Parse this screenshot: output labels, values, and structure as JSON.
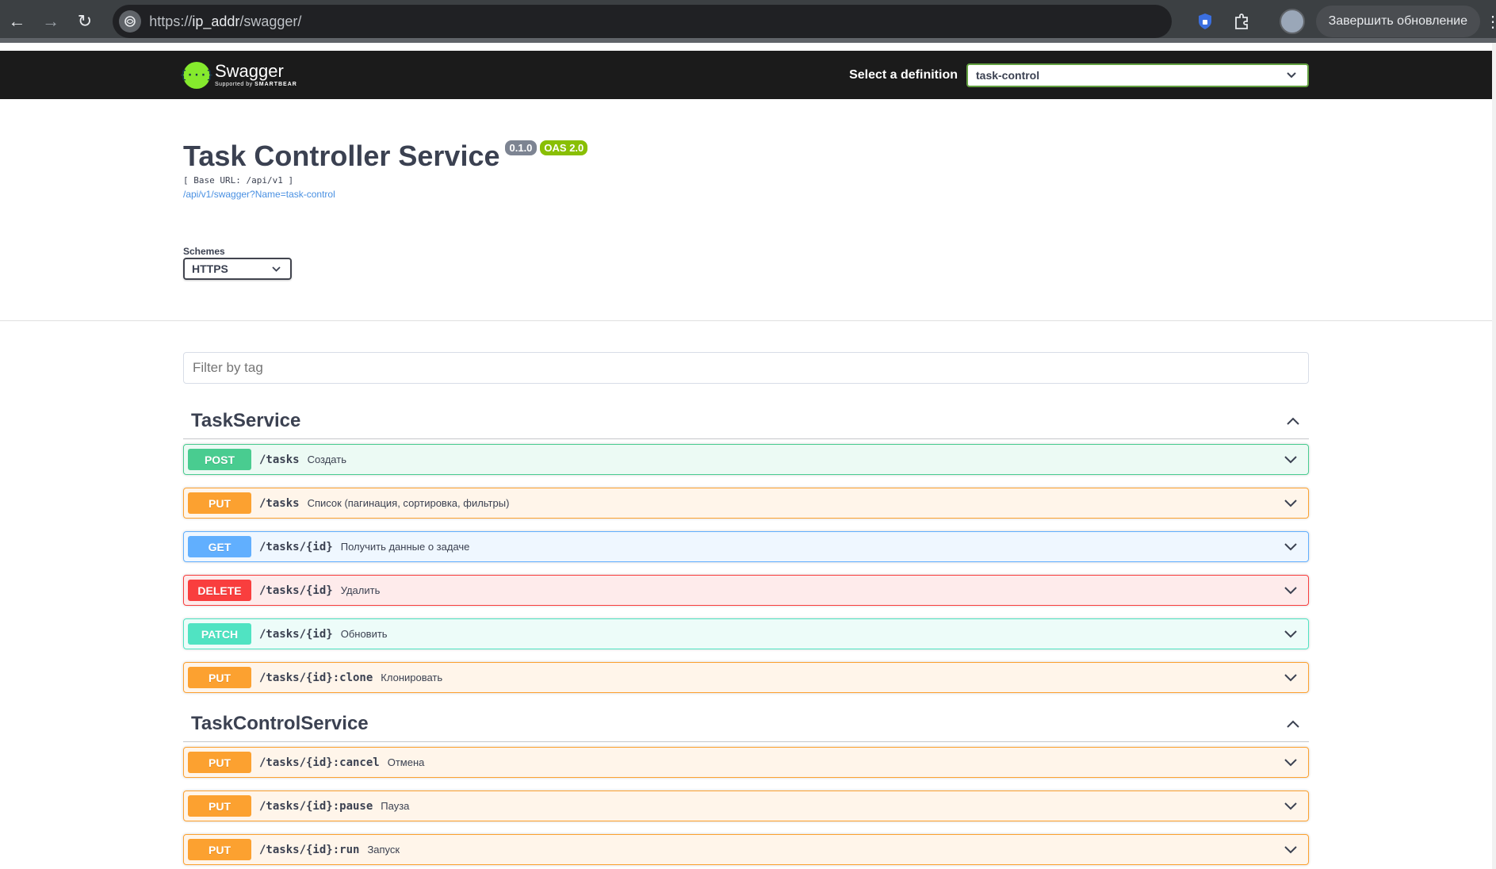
{
  "browser": {
    "url_prefix": "https://",
    "url_host": "ip_addr",
    "url_path": "/swagger/",
    "update_label": "Завершить обновление"
  },
  "topbar": {
    "brand_name": "Swagger",
    "brand_sub": "Supported by",
    "brand_sub_strong": "SMARTBEAR",
    "definition_label": "Select a definition",
    "definition_value": "task-control"
  },
  "info": {
    "title": "Task Controller Service",
    "version": "0.1.0",
    "oas": "OAS 2.0",
    "base_url": "[ Base URL: /api/v1 ]",
    "spec_link": "/api/v1/swagger?Name=task-control",
    "schemes_label": "Schemes",
    "schemes_value": "HTTPS"
  },
  "filter": {
    "placeholder": "Filter by tag"
  },
  "sections": [
    {
      "name": "TaskService",
      "ops": [
        {
          "method": "POST",
          "path": "/tasks",
          "summary": "Создать"
        },
        {
          "method": "PUT",
          "path": "/tasks",
          "summary": "Список (пагинация, сортировка, фильтры)"
        },
        {
          "method": "GET",
          "path": "/tasks/{id}",
          "summary": "Получить данные о задаче"
        },
        {
          "method": "DELETE",
          "path": "/tasks/{id}",
          "summary": "Удалить"
        },
        {
          "method": "PATCH",
          "path": "/tasks/{id}",
          "summary": "Обновить"
        },
        {
          "method": "PUT",
          "path": "/tasks/{id}:clone",
          "summary": "Клонировать"
        }
      ]
    },
    {
      "name": "TaskControlService",
      "ops": [
        {
          "method": "PUT",
          "path": "/tasks/{id}:cancel",
          "summary": "Отмена"
        },
        {
          "method": "PUT",
          "path": "/tasks/{id}:pause",
          "summary": "Пауза"
        },
        {
          "method": "PUT",
          "path": "/tasks/{id}:run",
          "summary": "Запуск"
        }
      ]
    }
  ],
  "colors": {
    "post": "#49cc90",
    "put": "#fca130",
    "get": "#61affe",
    "delete": "#f93e3e",
    "patch": "#50e3c2",
    "topbar": "#1b1b1b",
    "accent": "#85ea2d"
  },
  "icons": [
    "back-arrow-icon",
    "forward-arrow-icon",
    "reload-icon",
    "site-info-icon",
    "extension-icon",
    "puzzle-icon",
    "chevron-down-icon",
    "chevron-up-icon"
  ]
}
